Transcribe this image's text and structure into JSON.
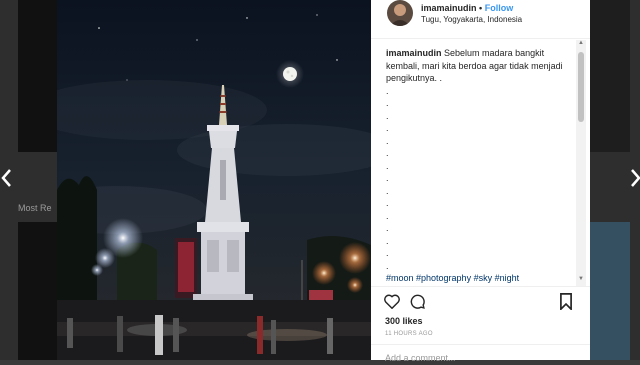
{
  "background": {
    "caption": "Most Re"
  },
  "post": {
    "username": "imamainudin",
    "separator": "•",
    "follow_label": "Follow",
    "location": "Tugu, Yogyakarta, Indonesia",
    "caption_user": "imamainudin",
    "caption_text": "Sebelum madara bangkit kembali, mari kita berdoa agar tidak menjadi pengikutnya. .",
    "caption_dots": [
      ".",
      ".",
      ".",
      ".",
      ".",
      ".",
      ".",
      ".",
      ".",
      ".",
      ".",
      ".",
      ".",
      ".",
      "."
    ],
    "hashtags": "#moon #photography #sky #night",
    "likes": "300 likes",
    "time_ago": "11 HOURS AGO",
    "comment_placeholder": "Add a comment..."
  },
  "icons": {
    "prev": "chevron-left-icon",
    "next": "chevron-right-icon",
    "like": "heart-icon",
    "comment": "comment-icon",
    "save": "bookmark-icon"
  },
  "colors": {
    "link_blue": "#3897f0",
    "hashtag_blue": "#003569",
    "text": "#262626",
    "muted": "#999999"
  }
}
